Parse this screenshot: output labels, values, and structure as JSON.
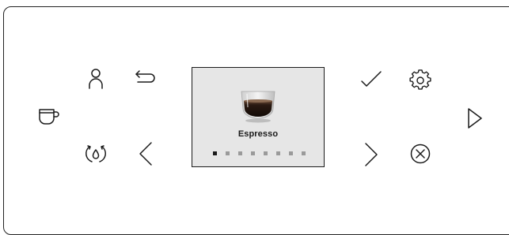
{
  "screen": {
    "drink_name": "Espresso",
    "page_indicator": {
      "total": 8,
      "current": 1
    }
  },
  "icons": [
    "cup-icon",
    "user-icon",
    "back-arrow-icon",
    "water-drop-icon",
    "chevron-left-icon",
    "checkmark-icon",
    "settings-gear-icon",
    "chevron-right-icon",
    "cancel-icon",
    "play-icon"
  ],
  "colors": {
    "stroke": "#1a1a1a",
    "screen_bg": "#e6e6e6",
    "dot_inactive": "#9a9a9a"
  }
}
